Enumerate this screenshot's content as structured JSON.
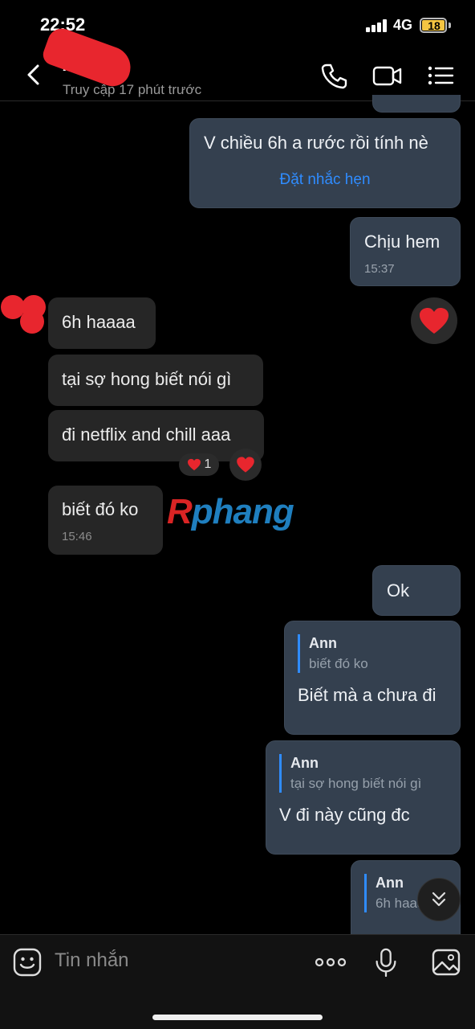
{
  "status_bar": {
    "time": "22:52",
    "network": "4G",
    "battery": "18"
  },
  "header": {
    "contact_name": "Ann",
    "last_seen": "Truy cập 17 phút trước"
  },
  "messages": {
    "m1": {
      "text": "V chiều 6h a rước rồi tính nè",
      "action": "Đặt nhắc hẹn"
    },
    "m2": {
      "text": "Chịu hem",
      "time": "15:37"
    },
    "m3": {
      "text": "6h haaaa"
    },
    "m4": {
      "text": "tại sợ hong biết nói gì"
    },
    "m5": {
      "text": "đi netflix and chill aaa",
      "reaction_count": "1"
    },
    "m6": {
      "text": "biết đó ko",
      "time": "15:46"
    },
    "m7": {
      "text": "Ok"
    },
    "m8": {
      "quote_name": "Ann",
      "quote_text": "biết đó ko",
      "text": "Biết mà a chưa đi"
    },
    "m9": {
      "quote_name": "Ann",
      "quote_text": "tại sợ hong biết nói gì",
      "text": "V đi này cũng đc"
    },
    "m10": {
      "quote_name": "Ann",
      "quote_text": "6h haaaa"
    }
  },
  "watermark": {
    "first": "R",
    "rest": "phang"
  },
  "composer": {
    "placeholder": "Tin nhắn"
  },
  "colors": {
    "accent": "#2f8cff",
    "outgoing_bubble": "#34404f",
    "incoming_bubble": "#262626",
    "heart": "#e8262e"
  }
}
